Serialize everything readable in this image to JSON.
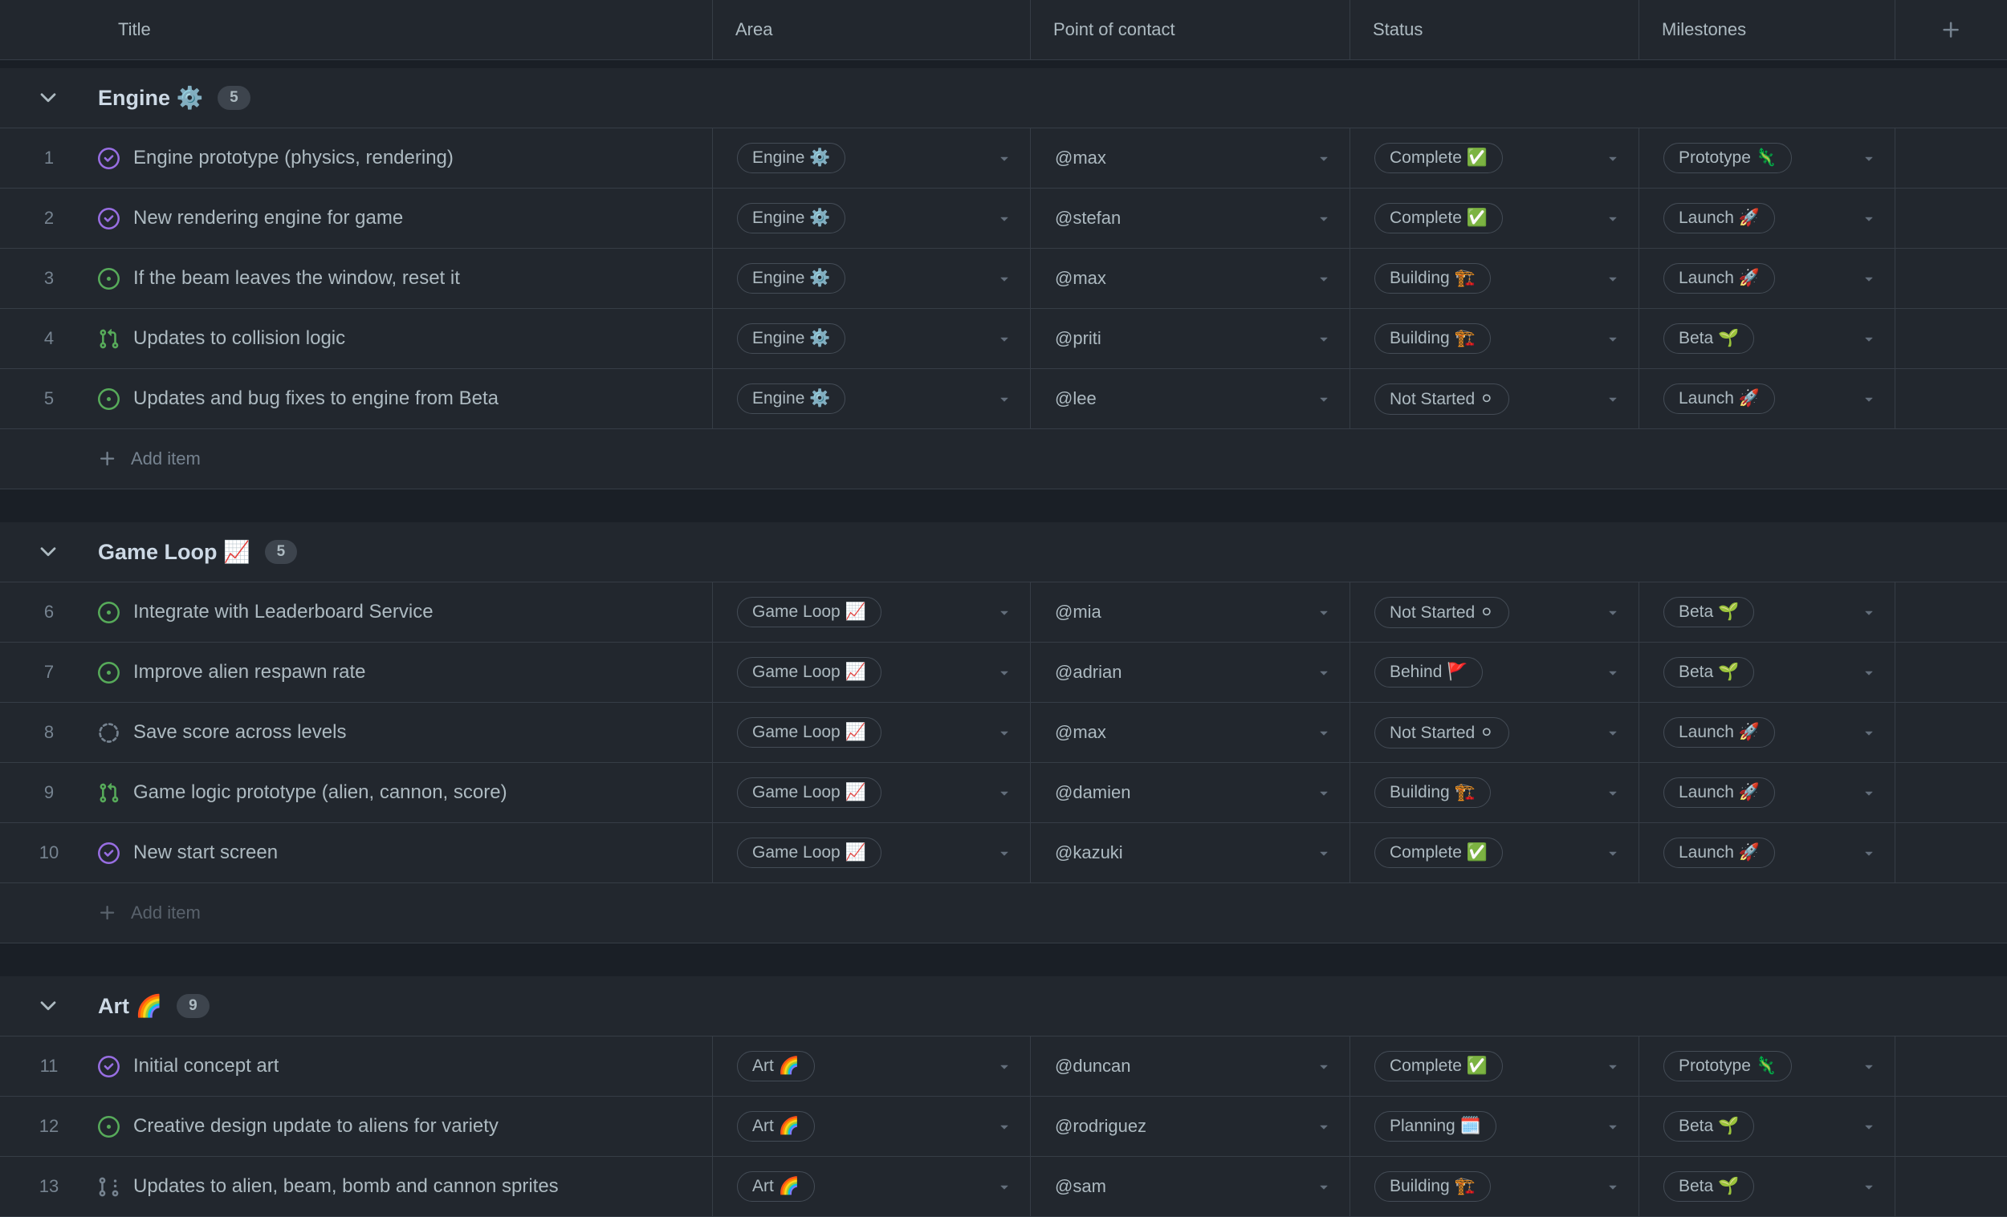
{
  "table": {
    "columns": [
      "Title",
      "Area",
      "Point of contact",
      "Status",
      "Milestones"
    ],
    "add_column_icon": "plus"
  },
  "colors": {
    "background": "#1a1f26",
    "row_background": "#22272e",
    "border": "#363d46",
    "text": "#adbac1",
    "muted": "#768390",
    "heading": "#cdd9e5",
    "issue_open_green": "#57ab5a",
    "issue_done_purple": "#986ee2"
  },
  "icons": {
    "issue-opened-icon": "green circle with dot",
    "issue-closed-icon": "purple circle with check",
    "pull-request-icon": "green pull request glyph",
    "draft-issue-icon": "dashed grey circle",
    "draft-pull-request-icon": "grey draft pull request glyph",
    "chevron-down-icon": "▾",
    "dropdown-caret-icon": "▾",
    "plus-icon": "+"
  },
  "groups": [
    {
      "label": "Engine ⚙️",
      "count": "5",
      "add_item_label": "Add item",
      "rows": [
        {
          "number": "1",
          "state": "completed",
          "title": "Engine prototype (physics, rendering)",
          "area": "Engine ⚙️",
          "contact": "@max",
          "status": "Complete ✅",
          "milestone": "Prototype 🦎"
        },
        {
          "number": "2",
          "state": "completed",
          "title": "New rendering engine for game",
          "area": "Engine ⚙️",
          "contact": "@stefan",
          "status": "Complete ✅",
          "milestone": "Launch 🚀"
        },
        {
          "number": "3",
          "state": "open",
          "title": "If the beam leaves the window, reset it",
          "area": "Engine ⚙️",
          "contact": "@max",
          "status": "Building 🏗️",
          "milestone": "Launch 🚀"
        },
        {
          "number": "4",
          "state": "pull-request",
          "title": "Updates to collision logic",
          "area": "Engine ⚙️",
          "contact": "@priti",
          "status": "Building 🏗️",
          "milestone": "Beta 🌱"
        },
        {
          "number": "5",
          "state": "open",
          "title": "Updates and bug fixes to engine from Beta",
          "area": "Engine ⚙️",
          "contact": "@lee",
          "status": "Not Started ⚪",
          "milestone": "Launch 🚀"
        }
      ]
    },
    {
      "label": "Game Loop 📈",
      "count": "5",
      "add_item_label": "Add item",
      "rows": [
        {
          "number": "6",
          "state": "open",
          "title": "Integrate with Leaderboard Service",
          "area": "Game Loop 📈",
          "contact": "@mia",
          "status": "Not Started ⚪",
          "milestone": "Beta 🌱"
        },
        {
          "number": "7",
          "state": "open",
          "title": "Improve alien respawn rate",
          "area": "Game Loop 📈",
          "contact": "@adrian",
          "status": "Behind 🚩",
          "milestone": "Beta 🌱"
        },
        {
          "number": "8",
          "state": "draft",
          "title": "Save score across levels",
          "area": "Game Loop 📈",
          "contact": "@max",
          "status": "Not Started ⚪",
          "milestone": "Launch 🚀"
        },
        {
          "number": "9",
          "state": "pull-request",
          "title": "Game logic prototype (alien, cannon, score)",
          "area": "Game Loop 📈",
          "contact": "@damien",
          "status": "Building 🏗️",
          "milestone": "Launch 🚀"
        },
        {
          "number": "10",
          "state": "completed",
          "title": "New start screen",
          "area": "Game Loop 📈",
          "contact": "@kazuki",
          "status": "Complete ✅",
          "milestone": "Launch 🚀"
        }
      ]
    },
    {
      "label": "Art 🌈",
      "count": "9",
      "add_item_label": "Add item",
      "rows": [
        {
          "number": "11",
          "state": "completed",
          "title": "Initial concept art",
          "area": "Art 🌈",
          "contact": "@duncan",
          "status": "Complete ✅",
          "milestone": "Prototype 🦎"
        },
        {
          "number": "12",
          "state": "open",
          "title": "Creative design update to aliens for variety",
          "area": "Art 🌈",
          "contact": "@rodriguez",
          "status": "Planning 🗓️",
          "milestone": "Beta 🌱"
        },
        {
          "number": "13",
          "state": "draft-pull-request",
          "title": "Updates to alien, beam, bomb and cannon sprites",
          "area": "Art 🌈",
          "contact": "@sam",
          "status": "Building 🏗️",
          "milestone": "Beta 🌱"
        }
      ]
    }
  ]
}
